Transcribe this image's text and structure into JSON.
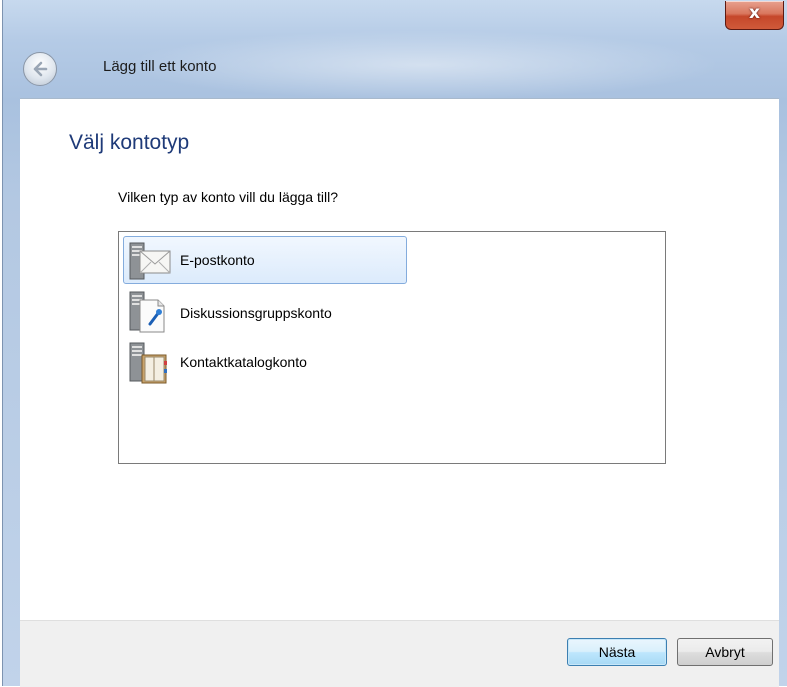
{
  "window": {
    "title": "Lägg till ett konto",
    "close_glyph": "x"
  },
  "page": {
    "heading": "Välj kontotyp",
    "question": "Vilken typ av konto vill du lägga till?"
  },
  "account_types": [
    {
      "label": "E-postkonto",
      "icon": "email-account-icon",
      "selected": true
    },
    {
      "label": "Diskussionsgruppskonto",
      "icon": "newsgroup-account-icon",
      "selected": false
    },
    {
      "label": "Kontaktkatalogkonto",
      "icon": "directory-account-icon",
      "selected": false
    }
  ],
  "buttons": {
    "next": "Nästa",
    "cancel": "Avbryt"
  },
  "colors": {
    "heading": "#1e3a78",
    "selection_border": "#84acdd",
    "close_red": "#c5472a"
  }
}
